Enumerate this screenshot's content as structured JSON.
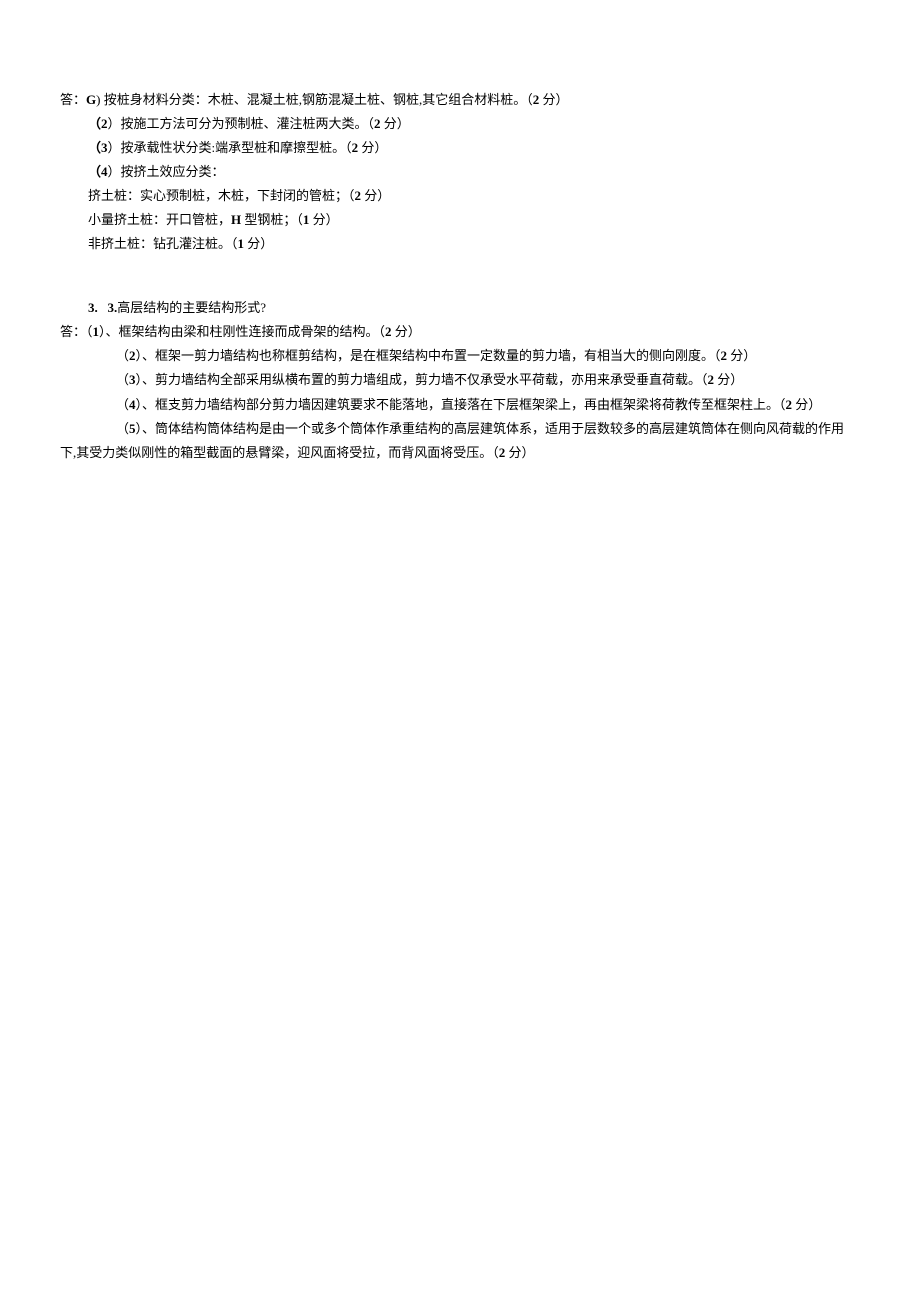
{
  "block1": {
    "line1_prefix": "答：",
    "line1_label": "G",
    "line1_text": ")  按桩身材料分类：木桩、混凝土桩,钢筋混凝土桩、钢桩,其它组合材料桩。（",
    "line1_points": "2",
    "line1_suffix": " 分）",
    "line2_label": "（2",
    "line2_text": "）按施工方法可分为预制桩、灌注桩两大类。（",
    "line2_points": "2",
    "line2_suffix": " 分）",
    "line3_label": "（3",
    "line3_text": "）按承载性状分类:端承型桩和摩擦型桩。（",
    "line3_points": "2",
    "line3_suffix": " 分）",
    "line4_label": "（4",
    "line4_text": "）按挤土效应分类：",
    "line5_text": "挤土桩：实心预制桩，木桩，下封闭的管桩；（",
    "line5_points": "2",
    "line5_suffix": " 分）",
    "line6_text": "小量挤土桩：开口管桩，",
    "line6_mid": "H",
    "line6_text2": " 型钢桩；（",
    "line6_points": "1",
    "line6_suffix": " 分）",
    "line7_text": "非挤土桩：钻孔灌注桩。（",
    "line7_points": "1",
    "line7_suffix": " 分）"
  },
  "block2": {
    "q_num1": "3.",
    "q_num2": "3.",
    "q_text": "高层结构的主要结构形式?",
    "a_prefix": "答：（",
    "a1_num": "1",
    "a1_text": "）、框架结构由梁和柱刚性连接而成骨架的结构。（",
    "a1_points": "2",
    "a1_suffix": " 分）",
    "a2_prefix": "（",
    "a2_num": "2",
    "a2_text": "）、框架一剪力墙结构也称框剪结构，是在框架结构中布置一定数量的剪力墙，有相当大的侧向刚度。（",
    "a2_points": "2",
    "a2_suffix": " 分）",
    "a3_prefix": "（",
    "a3_num": "3",
    "a3_text": "）、剪力墙结构全部采用纵横布置的剪力墙组成，剪力墙不仅承受水平荷载，亦用来承受垂直荷载。（",
    "a3_points": "2",
    "a3_suffix": " 分）",
    "a4_prefix": "（",
    "a4_num": "4",
    "a4_text": "）、框支剪力墙结构部分剪力墙因建筑要求不能落地，直接落在下层框架梁上，再由框架梁将荷教传至框架柱上。（",
    "a4_points": "2",
    "a4_suffix": " 分）",
    "a5_prefix": "（",
    "a5_num": "5",
    "a5_text": "）、筒体结构筒体结构是由一个或多个筒体作承重结构的高层建筑体系，适用于层数较多的高层建筑筒体在侧向风荷载的作用",
    "a5_cont": "下,其受力类似刚性的箱型截面的悬臂梁，迎风面将受拉，而背风面将受压。（",
    "a5_points": "2",
    "a5_suffix": " 分）"
  }
}
